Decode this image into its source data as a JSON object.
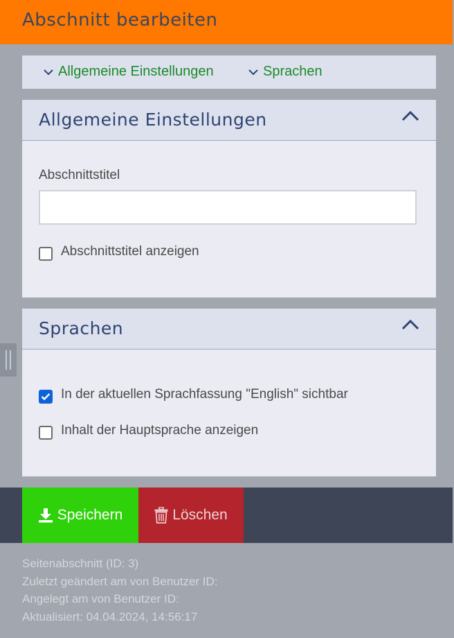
{
  "header": {
    "title": "Abschnitt bearbeiten"
  },
  "anchors": [
    {
      "label": "Allgemeine Einstellungen"
    },
    {
      "label": "Sprachen"
    }
  ],
  "general": {
    "title": "Allgemeine Einstellungen",
    "section_title_label": "Abschnittstitel",
    "section_title_value": "",
    "show_title_label": "Abschnittstitel anzeigen",
    "show_title_checked": false
  },
  "languages": {
    "title": "Sprachen",
    "visible_label": "In der aktuellen Sprachfassung \"English\" sichtbar",
    "visible_checked": true,
    "main_lang_label": "Inhalt der Hauptsprache anzeigen",
    "main_lang_checked": false
  },
  "toolbar": {
    "save_label": "Speichern",
    "delete_label": "Löschen"
  },
  "meta": {
    "line1": "Seitenabschnitt (ID: 3)",
    "line2": "Zuletzt geändert am von Benutzer ID:",
    "line3": "Angelegt am von Benutzer ID:",
    "line4": "Aktualisiert: 04.04.2024, 14:56:17"
  },
  "colors": {
    "header": "#ff7800",
    "accent_link": "#1b8a28",
    "save": "#2fd20a",
    "delete": "#b3242c",
    "checkbox_checked": "#0e62d9"
  }
}
